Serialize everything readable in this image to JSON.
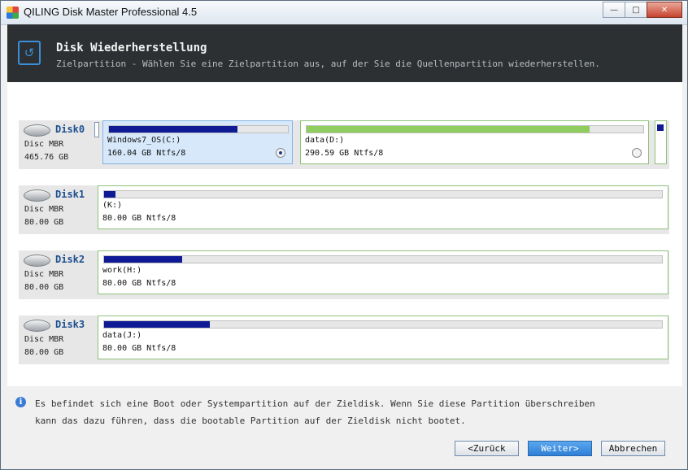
{
  "window": {
    "title": "QILING Disk Master Professional 4.5"
  },
  "header": {
    "title": "Disk Wiederherstellung",
    "subtitle": "Zielpartition - Wählen Sie eine Zielpartition aus, auf der Sie die Quellenpartition wiederherstellen."
  },
  "disks": [
    {
      "name": "Disk0",
      "type": "Disc MBR",
      "size": "465.76 GB",
      "partitions": [
        {
          "label": "Windows7_OS(C:)",
          "info": "160.04 GB Ntfs/8",
          "usage_fraction": 0.72,
          "selected": true
        },
        {
          "label": "data(D:)",
          "info": "290.59 GB Ntfs/8",
          "usage_fraction": 0.84,
          "selected": false
        }
      ]
    },
    {
      "name": "Disk1",
      "type": "Disc MBR",
      "size": "80.00 GB",
      "partitions": [
        {
          "label": "(K:)",
          "info": "80.00 GB Ntfs/8",
          "usage_fraction": 0.02
        }
      ]
    },
    {
      "name": "Disk2",
      "type": "Disc MBR",
      "size": "80.00 GB",
      "partitions": [
        {
          "label": "work(H:)",
          "info": "80.00 GB Ntfs/8",
          "usage_fraction": 0.14
        }
      ]
    },
    {
      "name": "Disk3",
      "type": "Disc MBR",
      "size": "80.00 GB",
      "partitions": [
        {
          "label": "data(J:)",
          "info": "80.00 GB Ntfs/8",
          "usage_fraction": 0.19
        }
      ]
    }
  ],
  "info": {
    "line1": "Es befindet sich eine Boot oder Systempartition auf der Zieldisk. Wenn Sie diese Partition überschreiben",
    "line2": "kann das dazu führen, dass die bootable Partition auf der Zieldisk nicht bootet."
  },
  "buttons": {
    "back": "<Zurück",
    "next": "Weiter>",
    "cancel": "Abbrechen"
  },
  "colors": {
    "used_bar": "#0e1b94",
    "used_bar_green": "#8fcd5e",
    "header_bg": "#2c3033",
    "accent": "#3b8fd8"
  }
}
